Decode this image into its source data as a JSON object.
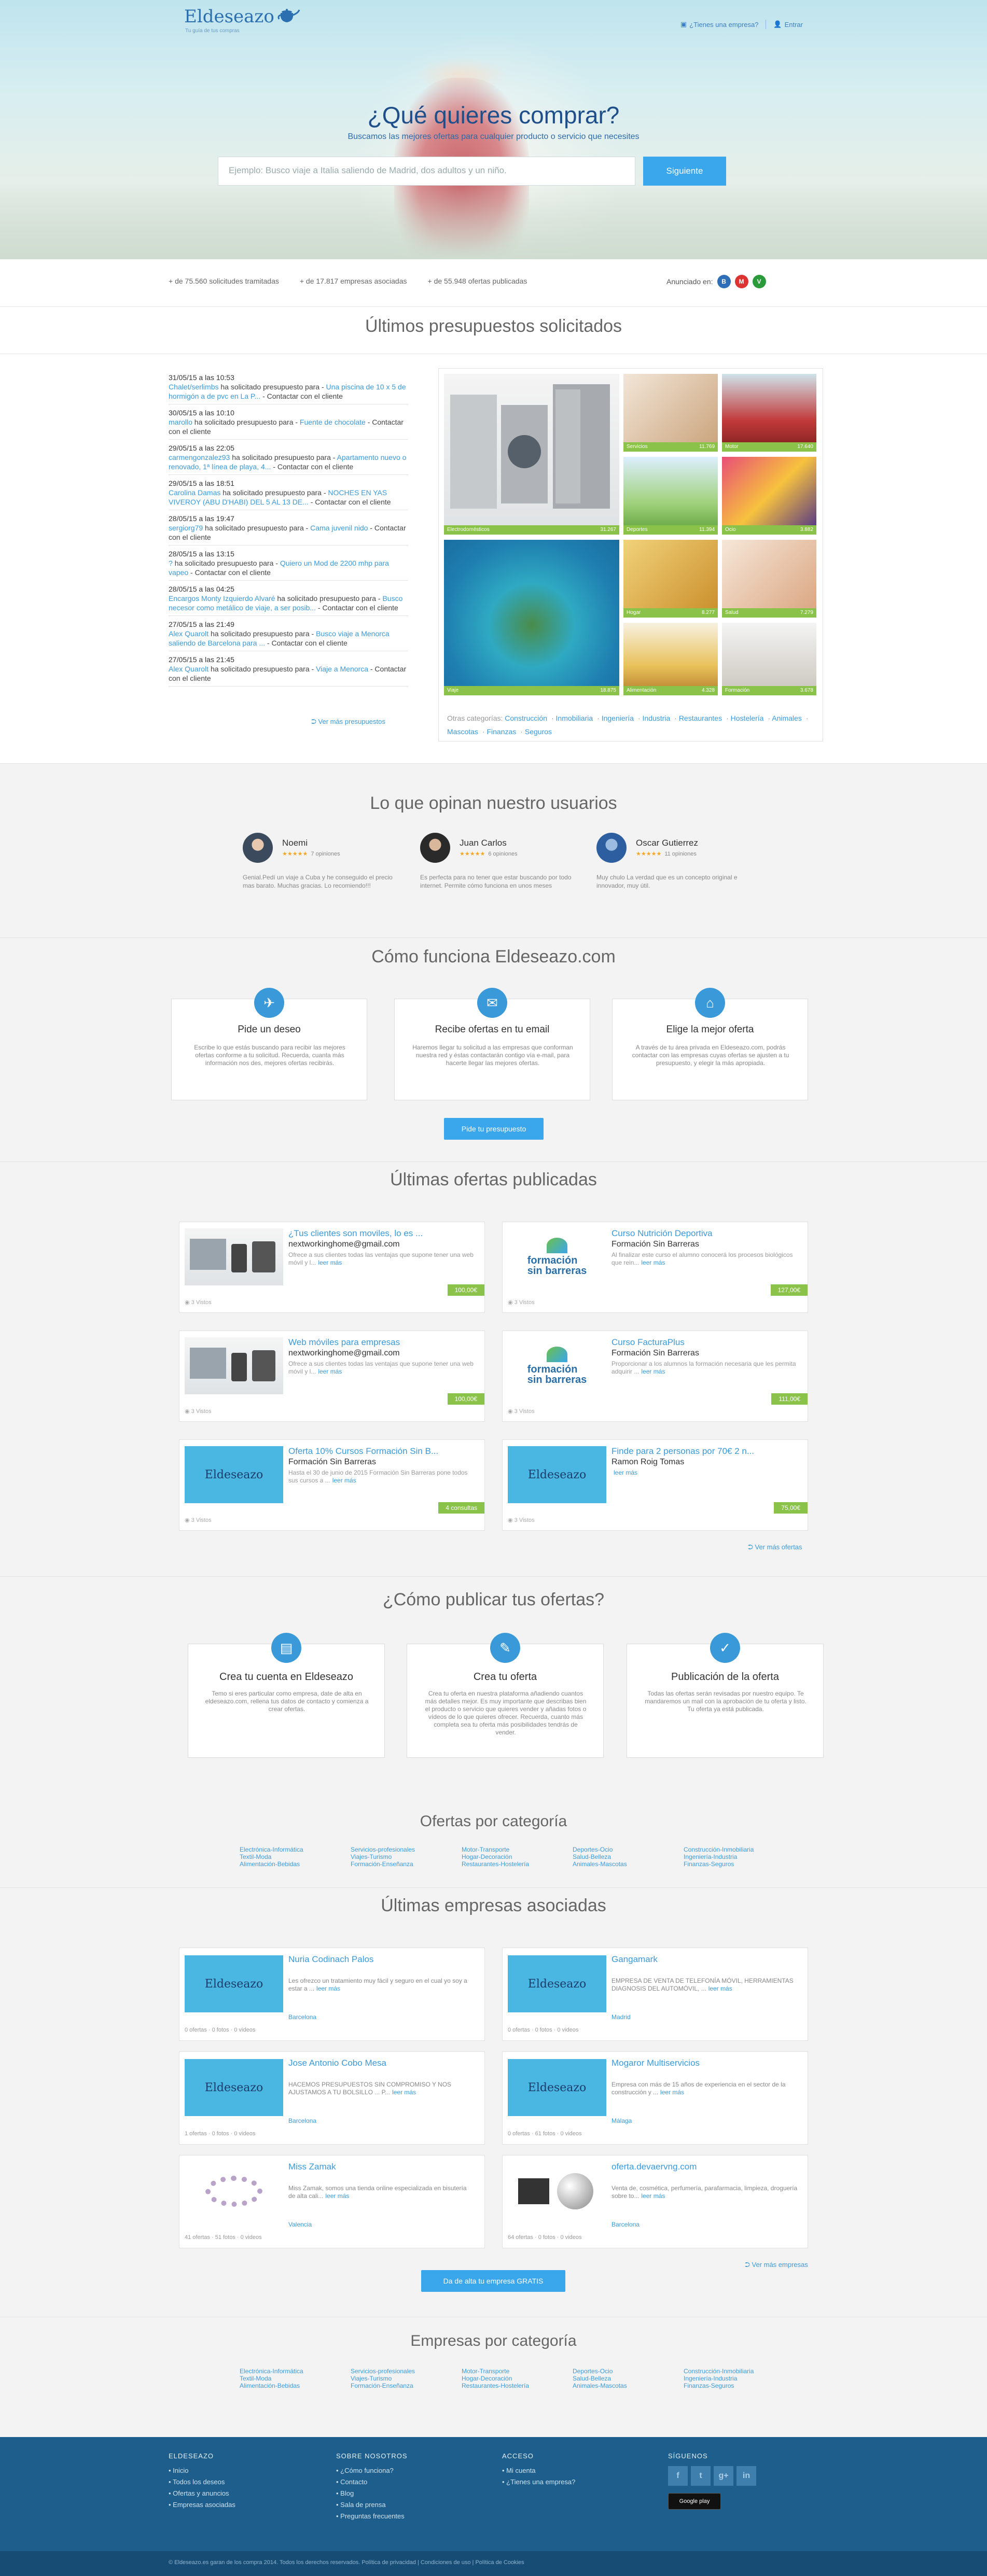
{
  "brand": {
    "name": "Eldeseazo",
    "tagline": "Tu guía de tus compras"
  },
  "topnav": {
    "companies": "¿Tienes una empresa?",
    "login": "Entrar"
  },
  "hero": {
    "title": "¿Qué quieres comprar?",
    "subtitle": "Buscamos las mejores ofertas para cualquier producto o servicio que necesites",
    "placeholder": "Ejemplo: Busco viaje a Italia saliendo de Madrid, dos adultos y un niño.",
    "button": "Siguiente"
  },
  "stats": {
    "items": [
      "+ de 75.560 solicitudes tramitadas",
      "+ de 17.817 empresas asociadas",
      "+ de 55.948 ofertas publicadas"
    ],
    "announced": "Anunciado en:",
    "media": [
      {
        "label": "B",
        "color": "#2f6fb7"
      },
      {
        "label": "M",
        "color": "#d33"
      },
      {
        "label": "V",
        "color": "#2a9a3a"
      }
    ]
  },
  "requests": {
    "title": "Últimos presupuestos solicitados",
    "items": [
      {
        "date": "31/05/15 a las 10:53",
        "user": "Chalet/serlimbs",
        "mid": "ha solicitado presupuesto para -",
        "what": "Una piscina de 10 x 5 de hormigón a de pvc en La P...",
        "end": "- Contactar con el cliente"
      },
      {
        "date": "30/05/15 a las 10:10",
        "user": "marollo",
        "mid": "ha solicitado presupuesto para -",
        "what": "Fuente de chocolate",
        "end": "- Contactar con el cliente"
      },
      {
        "date": "29/05/15 a las 22:05",
        "user": "carmengonzalez93",
        "mid": "ha solicitado presupuesto para -",
        "what": "Apartamento nuevo o renovado, 1ª línea de playa, 4...",
        "end": "- Contactar con el cliente"
      },
      {
        "date": "29/05/15 a las 18:51",
        "user": "Carolina Damas",
        "mid": "ha solicitado presupuesto para -",
        "what": "NOCHES EN YAS VIVEROY (ABU D'HABI) DEL 5 AL 13 DE...",
        "end": "- Contactar con el cliente"
      },
      {
        "date": "28/05/15 a las 19:47",
        "user": "sergiorg79",
        "mid": "ha solicitado presupuesto para -",
        "what": "Cama juvenil nido",
        "end": "- Contactar con el cliente"
      },
      {
        "date": "28/05/15 a las 13:15",
        "user": "?",
        "mid": "ha solicitado presupuesto para -",
        "what": "Quiero un Mod de 2200 mhp para vapeo",
        "end": "- Contactar con el cliente"
      },
      {
        "date": "28/05/15 a las 04:25",
        "user": "Encargos Monty Izquierdo Alvaré",
        "mid": "ha solicitado presupuesto para -",
        "what": "Busco necesor como metálico de viaje, a ser posib...",
        "end": "- Contactar con el cliente"
      },
      {
        "date": "27/05/15 a las 21:49",
        "user": "Alex Quarolt",
        "mid": "ha solicitado presupuesto para -",
        "what": "Busco viaje a Menorca saliendo de Barcelona para ...",
        "end": "- Contactar con el cliente"
      },
      {
        "date": "27/05/15 a las 21:45",
        "user": "Alex Quarolt",
        "mid": "ha solicitado presupuesto para -",
        "what": "Viaje a Menorca",
        "end": "- Contactar con el cliente"
      }
    ],
    "more": "Ver más presupuestos"
  },
  "categories": {
    "tiles": [
      {
        "name": "Electrodomésticos",
        "count": "31.267"
      },
      {
        "name": "Servicios",
        "count": "11.769"
      },
      {
        "name": "Motor",
        "count": "17.640"
      },
      {
        "name": "Deportes",
        "count": "11.394"
      },
      {
        "name": "Ocio",
        "count": "3.882"
      },
      {
        "name": "Viaje",
        "count": "18.875"
      },
      {
        "name": "Hogar",
        "count": "8.277"
      },
      {
        "name": "Salud",
        "count": "7.279"
      },
      {
        "name": "Alimentación",
        "count": "4.328"
      },
      {
        "name": "Formación",
        "count": "3.678"
      }
    ],
    "other_label": "Otras categorías:",
    "other": [
      "Construcción",
      "Inmobiliaria",
      "Ingeniería",
      "Industria",
      "Restaurantes",
      "Hostelería",
      "Animales",
      "Mascotas",
      "Finanzas",
      "Seguros"
    ]
  },
  "opinions": {
    "title": "Lo que opinan nuestro usuarios",
    "items": [
      {
        "name": "Noemi",
        "stars": "★★★★★",
        "count": "7 opiniones",
        "text": "Genial.Pedí un viaje a Cuba y he conseguido el precio mas barato. Muchas gracias. Lo recomiendo!!!"
      },
      {
        "name": "Juan Carlos",
        "stars": "★★★★★",
        "count": "6 opiniones",
        "text": "Es perfecta para no tener que estar buscando por todo internet. Permite cómo funciona en unos meses"
      },
      {
        "name": "Oscar Gutierrez",
        "stars": "★★★★★",
        "count": "11 opiniones",
        "text": "Muy chulo La verdad que es un concepto original e innovador, muy útil."
      }
    ]
  },
  "how": {
    "title": "Cómo funciona Eldeseazo.com",
    "boxes": [
      {
        "title": "Pide un deseo",
        "text": "Escribe lo que estás buscando para recibir las mejores ofertas conforme a tu solicitud. Recuerda, cuanta más información nos des, mejores ofertas recibirás."
      },
      {
        "title": "Recibe ofertas en tu email",
        "text": "Haremos llegar tu solicitud a las empresas que conforman nuestra red y éstas contactarán contigo vía e-mail, para hacerte llegar las mejores ofertas."
      },
      {
        "title": "Elige la mejor oferta",
        "text": "A través de tu área privada en Eldeseazo.com, podrás contactar con las empresas cuyas ofertas se ajusten a tu presupuesto, y elegir la más apropiada."
      }
    ],
    "button": "Pide tu presupuesto"
  },
  "offers": {
    "title": "Últimas ofertas publicadas",
    "items": [
      {
        "title": "¿Tus clientes son moviles, lo es ...",
        "company": "nextworkinghome@gmail.com",
        "desc": "Ofrece a sus clientes todas las ventajas que supone tener una web móvil y l...",
        "more": "leer más",
        "views": "3 Vistos",
        "price": "100,00€"
      },
      {
        "title": "Curso Nutrición Deportiva",
        "company": "Formación Sin Barreras",
        "desc": "Al finalizar este curso el alumno conocerá los procesos biológicos que rein...",
        "more": "leer más",
        "views": "3 Vistos",
        "price": "127,00€"
      },
      {
        "title": "Web móviles para empresas",
        "company": "nextworkinghome@gmail.com",
        "desc": "Ofrece a sus clientes todas las ventajas que supone tener una web móvil y l...",
        "more": "leer más",
        "views": "3 Vistos",
        "price": "100,00€"
      },
      {
        "title": "Curso FacturaPlus",
        "company": "Formación Sin Barreras",
        "desc": "Proporcionar a los alumnos la formación necesaria que les permita adquirir ...",
        "more": "leer más",
        "views": "3 Vistos",
        "price": "111,00€"
      },
      {
        "title": "Oferta 10% Cursos Formación Sin B...",
        "company": "Formación Sin Barreras",
        "desc": "Hasta el 30 de junio de 2015 Formación Sin Barreras pone todos sus cursos a ...",
        "more": "leer más",
        "views": "3 Vistos",
        "price": "4 consultas"
      },
      {
        "title": "Finde para 2 personas por 70€ 2 n...",
        "company": "Ramon Roig Tomas",
        "desc": "",
        "more": "leer más",
        "views": "3 Vistos",
        "price": "75,00€"
      }
    ],
    "more": "Ver más ofertas"
  },
  "publish": {
    "title": "¿Cómo publicar tus ofertas?",
    "boxes": [
      {
        "title": "Crea tu cuenta en Eldeseazo",
        "text": "Temo si eres particular como empresa, date de alta en eldeseazo.com, rellena tus datos de contacto y comienza a crear ofertas."
      },
      {
        "title": "Crea tu oferta",
        "text": "Crea tu oferta en nuestra plataforma añadiendo cuantos más detalles mejor. Es muy importante que describas bien el producto o servicio que quieres vender y añadas fotos o vídeos de lo que quieres ofrecer. Recuerda, cuanto más completa sea tu oferta más posibilidades tendrás de vender."
      },
      {
        "title": "Publicación de la oferta",
        "text": "Todas las ofertas serán revisadas por nuestro equipo. Te mandaremos un mail con la aprobación de tu oferta y listo. Tu oferta ya está publicada."
      }
    ]
  },
  "offer_cats": {
    "title": "Ofertas por categoría",
    "cols": [
      [
        "Electrónica-Informática",
        "Textil-Moda",
        "Alimentación-Bebidas"
      ],
      [
        "Servicios-profesionales",
        "Viajes-Turismo",
        "Formación-Enseñanza"
      ],
      [
        "Motor-Transporte",
        "Hogar-Decoración",
        "Restaurantes-Hostelería"
      ],
      [
        "Deportes-Ocio",
        "Salud-Belleza",
        "Animales-Mascotas"
      ],
      [
        "Construcción-Inmobiliaria",
        "Ingeniería-Industria",
        "Finanzas-Seguros"
      ]
    ]
  },
  "companies": {
    "title": "Últimas empresas asociadas",
    "items": [
      {
        "name": "Nuria Codinach Palos",
        "desc": "Les ofrezco un tratamiento muy fácil y seguro en el cual yo soy a estar a ...",
        "more": "leer más",
        "loc": "Barcelona",
        "foot": "0 ofertas · 0 fotos · 0 videos"
      },
      {
        "name": "Gangamark",
        "desc": "EMPRESA DE VENTA DE TELEFONÍA MÓVIL, HERRAMIENTAS DIAGNOSIS DEL AUTOMÓVIL, ...",
        "more": "leer más",
        "loc": "Madrid",
        "foot": "0 ofertas · 0 fotos · 0 videos"
      },
      {
        "name": "Jose Antonio Cobo Mesa",
        "desc": "HACEMOS PRESUPUESTOS SIN COMPROMISO Y NOS AJUSTAMOS A TU BOLSILLO ... P...",
        "more": "leer más",
        "loc": "Barcelona",
        "foot": "1 ofertas · 0 fotos · 0 videos"
      },
      {
        "name": "Mogaror Multiservicios",
        "desc": "Empresa con más de 15 años de experiencia en el sector de la construcción y ...",
        "more": "leer más",
        "loc": "Málaga",
        "foot": "0 ofertas · 61 fotos · 0 videos"
      },
      {
        "name": "Miss Zamak",
        "desc": "Miss Zamak, somos una tienda online especializada en bisutería de alta cali...",
        "more": "leer más",
        "loc": "Valencia",
        "foot": "41 ofertas · 51 fotos · 0 videos"
      },
      {
        "name": "oferta.devaervng.com",
        "desc": "Venta de, cosmética, perfumería, parafarmacia, limpieza, droguería sobre to...",
        "more": "leer más",
        "loc": "Barcelona",
        "foot": "64 ofertas · 0 fotos · 0 videos"
      }
    ],
    "more": "Ver más empresas",
    "button": "Da de alta tu empresa GRATIS"
  },
  "company_cats": {
    "title": "Empresas por categoría",
    "cols": [
      [
        "Electrónica-Informática",
        "Textil-Moda",
        "Alimentación-Bebidas"
      ],
      [
        "Servicios-profesionales",
        "Viajes-Turismo",
        "Formación-Enseñanza"
      ],
      [
        "Motor-Transporte",
        "Hogar-Decoración",
        "Restaurantes-Hostelería"
      ],
      [
        "Deportes-Ocio",
        "Salud-Belleza",
        "Animales-Mascotas"
      ],
      [
        "Construcción-Inmobiliaria",
        "Ingeniería-Industria",
        "Finanzas-Seguros"
      ]
    ]
  },
  "footer": {
    "cols": [
      {
        "title": "ELDESEAZO",
        "items": [
          "Inicio",
          "Todos los deseos",
          "Ofertas y anuncios",
          "Empresas asociadas"
        ]
      },
      {
        "title": "SOBRE NOSOTROS",
        "items": [
          "¿Cómo funciona?",
          "Contacto",
          "Blog",
          "Sala de prensa",
          "Preguntas frecuentes"
        ]
      },
      {
        "title": "ACCESO",
        "items": [
          "Mi cuenta",
          "¿Tienes una empresa?"
        ]
      },
      {
        "title": "SÍGUENOS",
        "items": []
      }
    ],
    "social": [
      "f",
      "t",
      "g+",
      "in"
    ],
    "store": "Google play",
    "copyright": "© Eldeseazo.es garan de los compra 2014. Todos los derechos reservados. Política de privacidad | Condiciones de uso | Política de Cookies"
  }
}
